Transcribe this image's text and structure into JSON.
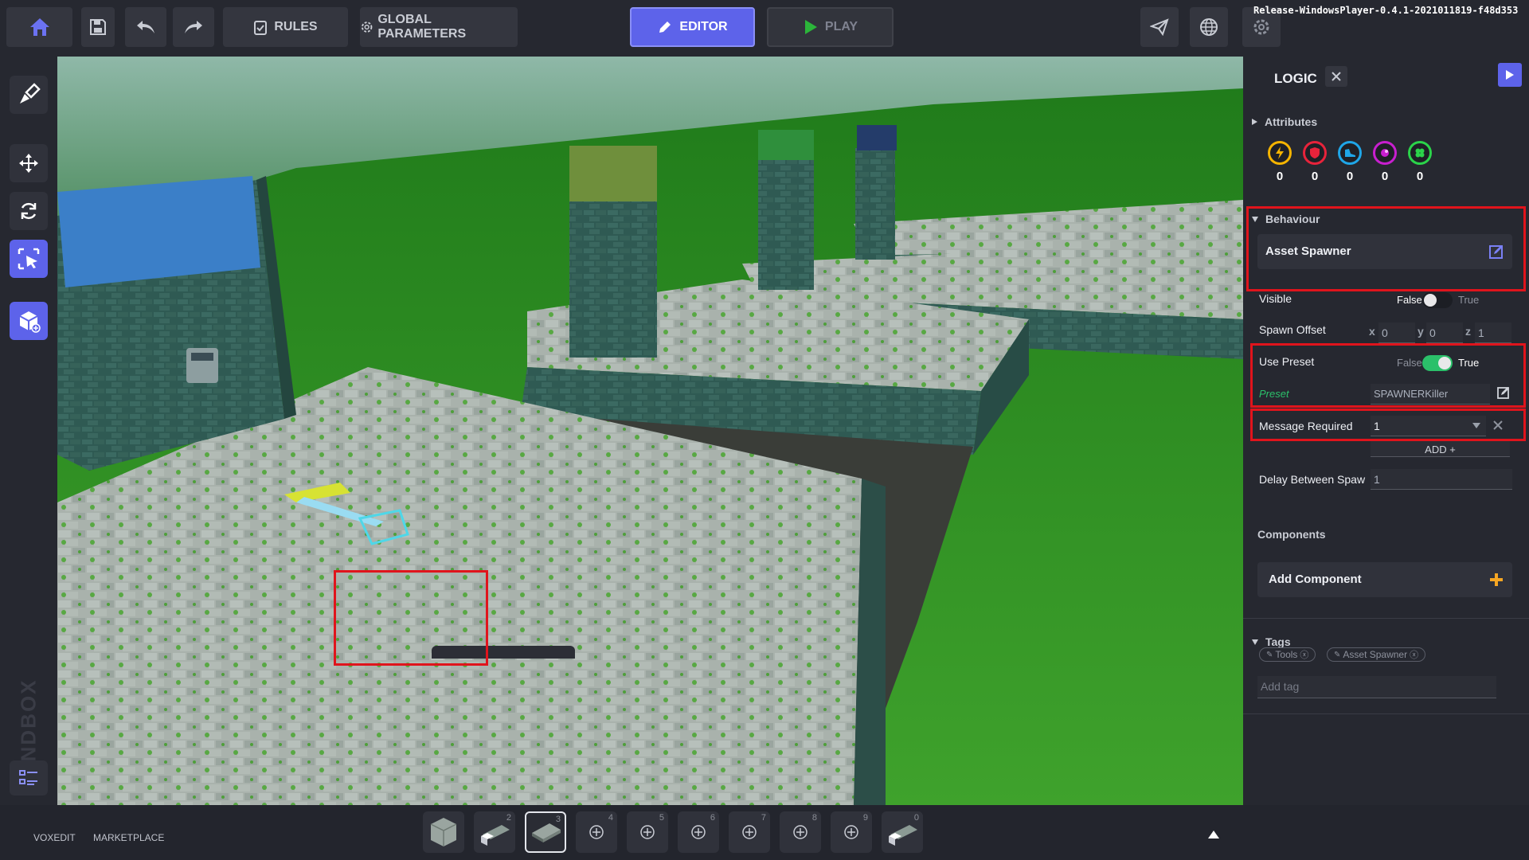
{
  "topbar": {
    "home_icon": "home-icon",
    "save_icon": "save-icon",
    "undo_icon": "undo-icon",
    "redo_icon": "redo-icon",
    "rules_label": "RULES",
    "global_params_label": "GLOBAL PARAMETERS",
    "editor_label": "EDITOR",
    "play_label": "PLAY",
    "build_info": "Release-WindowsPlayer-0.4.1-2021011819-f48d353",
    "accent_color": "#5d63ea"
  },
  "leftbar": {
    "tools": [
      "paint-icon",
      "move-icon",
      "rotate-icon",
      "select-icon",
      "cube-add-icon"
    ],
    "brand": "SANDBOX",
    "list_icon": "list-icon"
  },
  "panel": {
    "title": "LOGIC",
    "attributes_label": "Attributes",
    "attributes": [
      {
        "icon": "energy-icon",
        "color": "#f5b400",
        "value": "0"
      },
      {
        "icon": "shield-icon",
        "color": "#e8233b",
        "value": "0"
      },
      {
        "icon": "boot-icon",
        "color": "#1fa6e8",
        "value": "0"
      },
      {
        "icon": "magic-icon",
        "color": "#c81fcf",
        "value": "0"
      },
      {
        "icon": "clover-icon",
        "color": "#2bd34a",
        "value": "0"
      }
    ],
    "behaviour_label": "Behaviour",
    "behaviour_name": "Asset Spawner",
    "visible_label": "Visible",
    "visible_false": "False",
    "visible_true": "True",
    "visible_value": false,
    "spawn_offset_label": "Spawn Offset",
    "offset_x_label": "x",
    "offset_x": "0",
    "offset_y_label": "y",
    "offset_y": "0",
    "offset_z_label": "z",
    "offset_z": "1",
    "use_preset_label": "Use Preset",
    "use_preset_false": "False",
    "use_preset_true": "True",
    "use_preset_value": true,
    "preset_label": "Preset",
    "preset_value": "SPAWNERKiller",
    "message_required_label": "Message Required",
    "message_required_value": "1",
    "add_label": "ADD +",
    "delay_label": "Delay Between Spaw",
    "delay_value": "1",
    "components_label": "Components",
    "add_component_label": "Add Component",
    "tags_label": "Tags",
    "tags": [
      "Tools",
      "Asset Spawner"
    ],
    "add_tag_placeholder": "Add tag"
  },
  "bottombar": {
    "voxedit_label": "VOXEDIT",
    "marketplace_label": "MARKETPLACE",
    "slots": [
      {
        "num": "",
        "content": "stone-cube"
      },
      {
        "num": "2",
        "content": "spawner-block"
      },
      {
        "num": "3",
        "content": "floor-tile"
      },
      {
        "num": "4",
        "content": "add"
      },
      {
        "num": "5",
        "content": "add"
      },
      {
        "num": "6",
        "content": "add"
      },
      {
        "num": "7",
        "content": "add"
      },
      {
        "num": "8",
        "content": "add"
      },
      {
        "num": "9",
        "content": "add"
      },
      {
        "num": "0",
        "content": "spawner-block"
      }
    ],
    "selected_slot": 2
  }
}
